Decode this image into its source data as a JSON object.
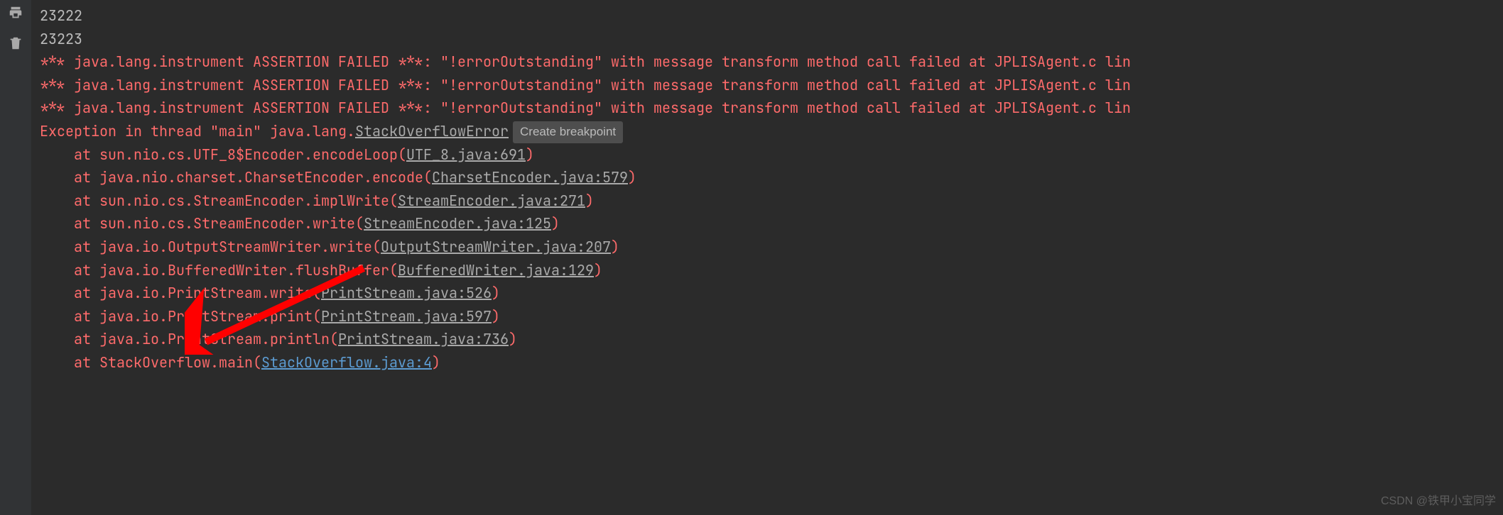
{
  "output_lines": [
    "23222",
    "23223"
  ],
  "assertion_line": "*** java.lang.instrument ASSERTION FAILED ***: \"!errorOutstanding\" with message transform method call failed at JPLISAgent.c lin",
  "assertion_repeat": 3,
  "exception_prefix": "Exception in thread \"main\" java.lang.",
  "exception_link": "StackOverflowError",
  "breakpoint_hint": "Create breakpoint",
  "stack": [
    {
      "prefix": "    at sun.nio.cs.UTF_8$Encoder.encodeLoop(",
      "link": "UTF_8.java:691",
      "suffix": ")",
      "type": "gray"
    },
    {
      "prefix": "    at java.nio.charset.CharsetEncoder.encode(",
      "link": "CharsetEncoder.java:579",
      "suffix": ")",
      "type": "gray"
    },
    {
      "prefix": "    at sun.nio.cs.StreamEncoder.implWrite(",
      "link": "StreamEncoder.java:271",
      "suffix": ")",
      "type": "gray"
    },
    {
      "prefix": "    at sun.nio.cs.StreamEncoder.write(",
      "link": "StreamEncoder.java:125",
      "suffix": ")",
      "type": "gray"
    },
    {
      "prefix": "    at java.io.OutputStreamWriter.write(",
      "link": "OutputStreamWriter.java:207",
      "suffix": ")",
      "type": "gray"
    },
    {
      "prefix": "    at java.io.BufferedWriter.flushBuffer(",
      "link": "BufferedWriter.java:129",
      "suffix": ")",
      "type": "gray"
    },
    {
      "prefix": "    at java.io.PrintStream.write(",
      "link": "PrintStream.java:526",
      "suffix": ")",
      "type": "gray"
    },
    {
      "prefix": "    at java.io.PrintStream.print(",
      "link": "PrintStream.java:597",
      "suffix": ")",
      "type": "gray"
    },
    {
      "prefix": "    at java.io.PrintStream.println(",
      "link": "PrintStream.java:736",
      "suffix": ")",
      "type": "gray"
    },
    {
      "prefix": "    at StackOverflow.main(",
      "link": "StackOverflow.java:4",
      "suffix": ")",
      "type": "blue"
    }
  ],
  "watermark": "CSDN @铁甲小宝同学",
  "icons": {
    "print": "print-icon",
    "trash": "trash-icon"
  }
}
